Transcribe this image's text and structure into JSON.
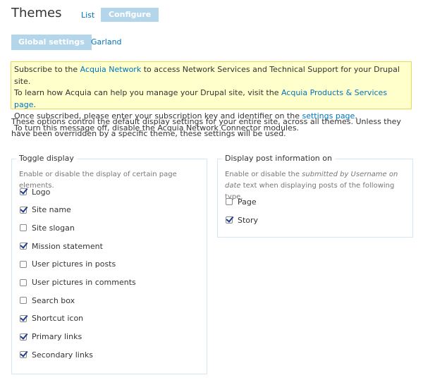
{
  "page": {
    "title": "Themes"
  },
  "tabs": {
    "list": "List",
    "configure": "Configure"
  },
  "subtabs": {
    "global": "Global settings",
    "garland": "Garland"
  },
  "message": {
    "line1_pre": "Subscribe to the ",
    "line1_link": "Acquia Network",
    "line1_post": " to access Network Services and Technical Support for your Drupal site.",
    "line2_pre": "To learn how Acquia can help you manage your Drupal site, visit the ",
    "line2_link": "Acquia Products & Services page",
    "line2_post": ".",
    "line3_pre": "Once subscribed, please enter your subscription key and identifier on the ",
    "line3_link": "settings page",
    "line3_post": ".",
    "line4": "To turn this message off, disable the Acquia Network Connector modules."
  },
  "description": "These options control the default display settings for your entire site, across all themes. Unless they have been overridden by a specific theme, these settings will be used.",
  "toggle_display": {
    "legend": "Toggle display",
    "description": "Enable or disable the display of certain page elements.",
    "items": [
      {
        "label": "Logo",
        "checked": true
      },
      {
        "label": "Site name",
        "checked": true
      },
      {
        "label": "Site slogan",
        "checked": false
      },
      {
        "label": "Mission statement",
        "checked": true
      },
      {
        "label": "User pictures in posts",
        "checked": false
      },
      {
        "label": "User pictures in comments",
        "checked": false
      },
      {
        "label": "Search box",
        "checked": false
      },
      {
        "label": "Shortcut icon",
        "checked": true
      },
      {
        "label": "Primary links",
        "checked": true
      },
      {
        "label": "Secondary links",
        "checked": true
      }
    ]
  },
  "post_info": {
    "legend": "Display post information on",
    "desc_pre": "Enable or disable the ",
    "desc_em": "submitted by Username on date",
    "desc_post": " text when displaying posts of the following type.",
    "items": [
      {
        "label": "Page",
        "checked": false
      },
      {
        "label": "Story",
        "checked": true
      }
    ]
  }
}
